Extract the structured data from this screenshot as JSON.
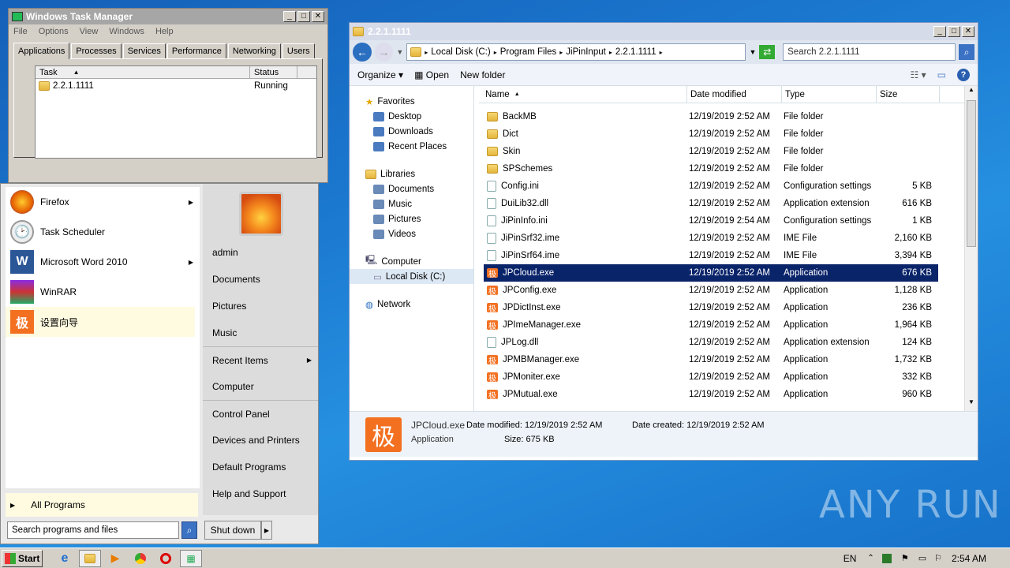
{
  "task_manager": {
    "title": "Windows Task Manager",
    "menu": [
      "File",
      "Options",
      "View",
      "Windows",
      "Help"
    ],
    "tabs": [
      "Applications",
      "Processes",
      "Services",
      "Performance",
      "Networking",
      "Users"
    ],
    "col_task": "Task",
    "col_status": "Status",
    "rows": [
      {
        "task": "2.2.1.1111",
        "status": "Running"
      }
    ]
  },
  "explorer": {
    "title": "2.2.1.1111",
    "breadcrumb": [
      "Local Disk (C:)",
      "Program Files",
      "JiPinInput",
      "2.2.1.1111"
    ],
    "search_placeholder": "Search 2.2.1.1111",
    "cmd": {
      "organize": "Organize",
      "open": "Open",
      "new_folder": "New folder"
    },
    "nav": {
      "favorites": "Favorites",
      "fav_items": [
        "Desktop",
        "Downloads",
        "Recent Places"
      ],
      "libraries": "Libraries",
      "lib_items": [
        "Documents",
        "Music",
        "Pictures",
        "Videos"
      ],
      "computer": "Computer",
      "local_disk": "Local Disk (C:)",
      "network": "Network"
    },
    "columns": [
      "Name",
      "Date modified",
      "Type",
      "Size"
    ],
    "files": [
      {
        "name": "BackMB",
        "date": "12/19/2019 2:52 AM",
        "type": "File folder",
        "size": "",
        "kind": "folder"
      },
      {
        "name": "Dict",
        "date": "12/19/2019 2:52 AM",
        "type": "File folder",
        "size": "",
        "kind": "folder"
      },
      {
        "name": "Skin",
        "date": "12/19/2019 2:52 AM",
        "type": "File folder",
        "size": "",
        "kind": "folder"
      },
      {
        "name": "SPSchemes",
        "date": "12/19/2019 2:52 AM",
        "type": "File folder",
        "size": "",
        "kind": "folder"
      },
      {
        "name": "Config.ini",
        "date": "12/19/2019 2:52 AM",
        "type": "Configuration settings",
        "size": "5 KB",
        "kind": "file"
      },
      {
        "name": "DuiLib32.dll",
        "date": "12/19/2019 2:52 AM",
        "type": "Application extension",
        "size": "616 KB",
        "kind": "file"
      },
      {
        "name": "JiPinInfo.ini",
        "date": "12/19/2019 2:54 AM",
        "type": "Configuration settings",
        "size": "1 KB",
        "kind": "file"
      },
      {
        "name": "JiPinSrf32.ime",
        "date": "12/19/2019 2:52 AM",
        "type": "IME File",
        "size": "2,160 KB",
        "kind": "file"
      },
      {
        "name": "JiPinSrf64.ime",
        "date": "12/19/2019 2:52 AM",
        "type": "IME File",
        "size": "3,394 KB",
        "kind": "file"
      },
      {
        "name": "JPCloud.exe",
        "date": "12/19/2019 2:52 AM",
        "type": "Application",
        "size": "676 KB",
        "kind": "app",
        "selected": true
      },
      {
        "name": "JPConfig.exe",
        "date": "12/19/2019 2:52 AM",
        "type": "Application",
        "size": "1,128 KB",
        "kind": "app"
      },
      {
        "name": "JPDictInst.exe",
        "date": "12/19/2019 2:52 AM",
        "type": "Application",
        "size": "236 KB",
        "kind": "app"
      },
      {
        "name": "JPImeManager.exe",
        "date": "12/19/2019 2:52 AM",
        "type": "Application",
        "size": "1,964 KB",
        "kind": "app"
      },
      {
        "name": "JPLog.dll",
        "date": "12/19/2019 2:52 AM",
        "type": "Application extension",
        "size": "124 KB",
        "kind": "file"
      },
      {
        "name": "JPMBManager.exe",
        "date": "12/19/2019 2:52 AM",
        "type": "Application",
        "size": "1,732 KB",
        "kind": "app"
      },
      {
        "name": "JPMoniter.exe",
        "date": "12/19/2019 2:52 AM",
        "type": "Application",
        "size": "332 KB",
        "kind": "app"
      },
      {
        "name": "JPMutual.exe",
        "date": "12/19/2019 2:52 AM",
        "type": "Application",
        "size": "960 KB",
        "kind": "app"
      }
    ],
    "details": {
      "name": "JPCloud.exe",
      "type": "Application",
      "date_modified_label": "Date modified:",
      "date_modified": "12/19/2019 2:52 AM",
      "date_created_label": "Date created:",
      "date_created": "12/19/2019 2:52 AM",
      "size_label": "Size:",
      "size": "675 KB",
      "icon_char": "极"
    }
  },
  "start_menu": {
    "programs": [
      {
        "label": "Firefox",
        "arrow": true
      },
      {
        "label": "Task Scheduler",
        "arrow": false
      },
      {
        "label": "Microsoft Word 2010",
        "arrow": true
      },
      {
        "label": "WinRAR",
        "arrow": false
      },
      {
        "label": "设置向导",
        "arrow": false
      }
    ],
    "all_programs": "All Programs",
    "search_placeholder": "Search programs and files",
    "right": [
      "admin",
      "Documents",
      "Pictures",
      "Music",
      "Recent Items",
      "Computer",
      "Control Panel",
      "Devices and Printers",
      "Default Programs",
      "Help and Support"
    ],
    "shutdown": "Shut down"
  },
  "taskbar": {
    "start": "Start",
    "lang": "EN",
    "time": "2:54 AM"
  },
  "watermark": "ANY RUN"
}
